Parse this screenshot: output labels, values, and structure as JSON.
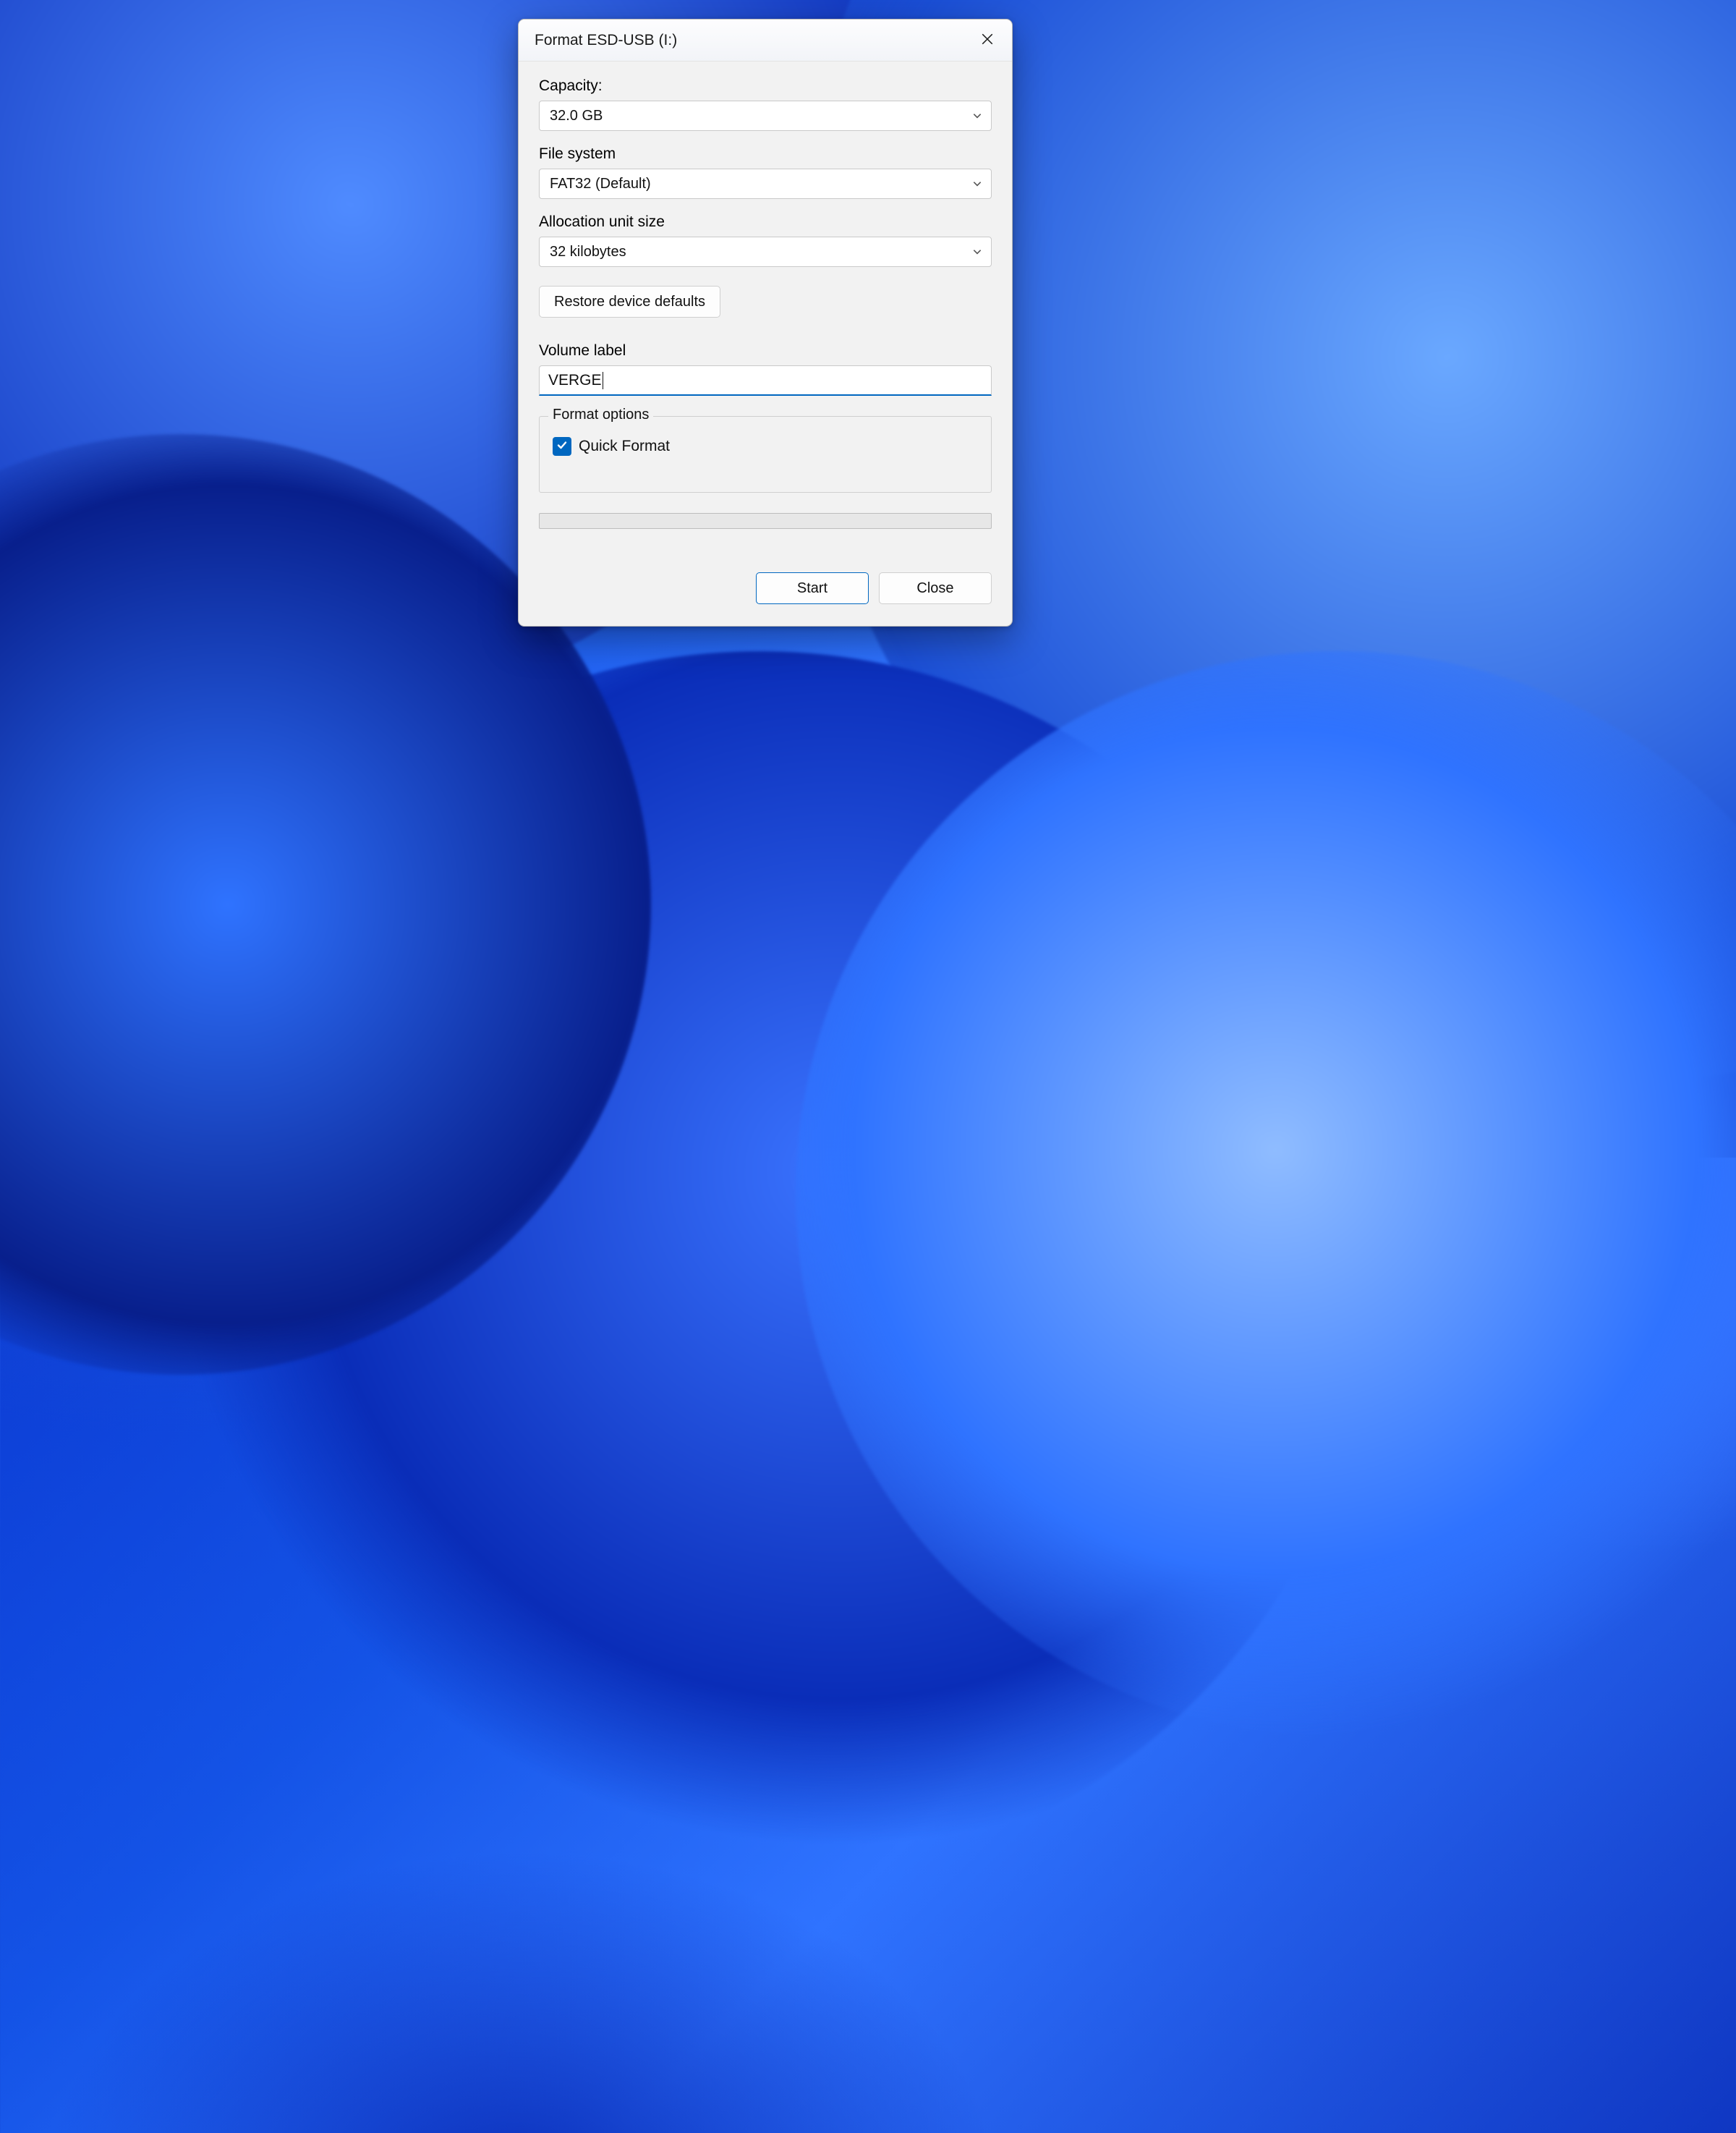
{
  "dialog": {
    "title": "Format ESD-USB (I:)",
    "capacity": {
      "label": "Capacity:",
      "value": "32.0 GB"
    },
    "filesystem": {
      "label": "File system",
      "value": "FAT32 (Default)"
    },
    "allocation": {
      "label": "Allocation unit size",
      "value": "32 kilobytes"
    },
    "restore_defaults": "Restore device defaults",
    "volume_label": {
      "label": "Volume label",
      "value": "VERGE"
    },
    "options": {
      "legend": "Format options",
      "quick_format_label": "Quick Format",
      "quick_format_checked": true
    },
    "buttons": {
      "start": "Start",
      "close": "Close"
    }
  }
}
